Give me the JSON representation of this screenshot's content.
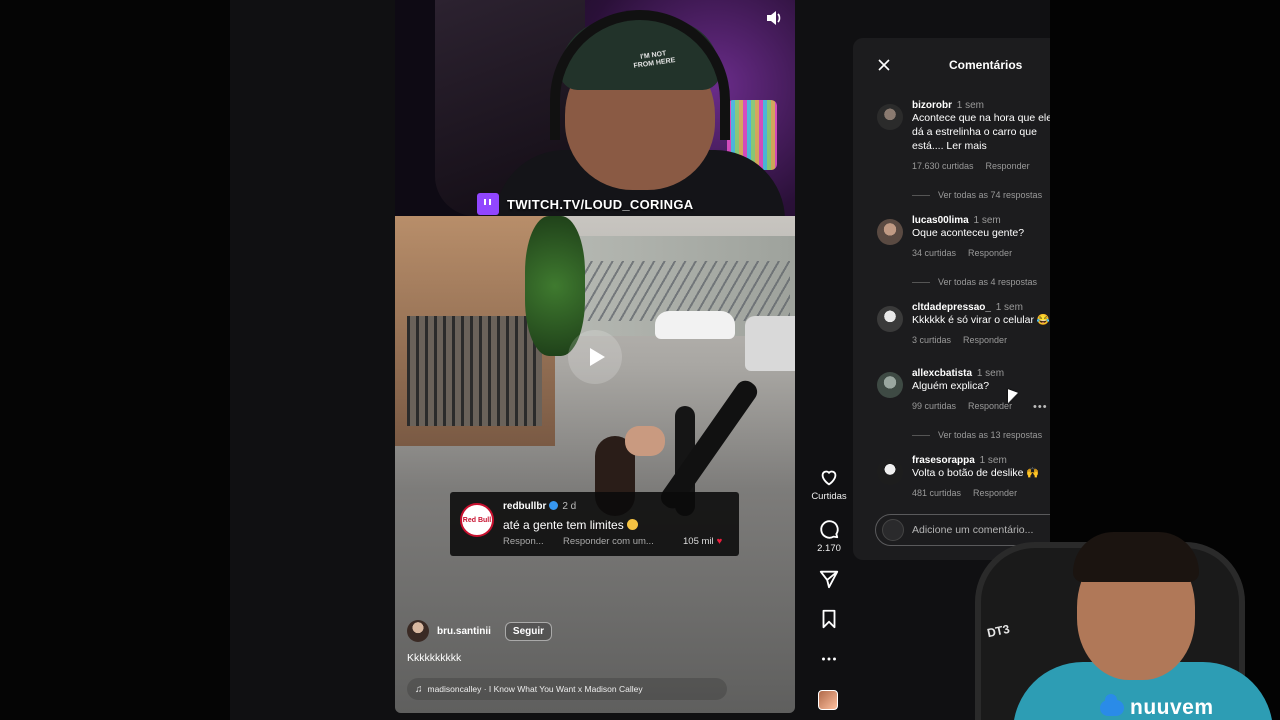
{
  "video": {
    "stream_overlay": "TWITCH.TV/LOUD_CORINGA",
    "cap_text": "I'M NOT\nFROM HERE",
    "reply_card": {
      "brand_logo": "Red Bull",
      "username": "redbullbr",
      "time": "2 d",
      "text": "até a gente tem limites",
      "reply_label": "Respon...",
      "reply_with_label": "Responder com um...",
      "likes": "105 mil"
    },
    "owner": {
      "username": "bru.santinii",
      "follow_label": "Seguir"
    },
    "caption": "Kkkkkkkkkk",
    "music": "madisoncalley · I Know What You Want x Madison Calley"
  },
  "rail": {
    "like_label": "Curtidas",
    "comment_count": "2.170"
  },
  "comments_panel": {
    "title": "Comentários",
    "input_placeholder": "Adicione um comentário...",
    "comments": [
      {
        "username": "bizorobr",
        "time": "1 sem",
        "text": "Acontece que na hora que ele\ndá a estrelinha o carro que\nestá.... Ler mais",
        "likes": "17.630 curtidas",
        "reply_label": "Responder",
        "view_replies": "Ver todas as 74 respostas"
      },
      {
        "username": "lucas00lima",
        "time": "1 sem",
        "text": "Oque aconteceu gente?",
        "likes": "34 curtidas",
        "reply_label": "Responder",
        "view_replies": "Ver todas as 4 respostas"
      },
      {
        "username": "cltdadepressao_",
        "time": "1 sem",
        "text": "Kkkkkk é só virar o celular 😂",
        "likes": "3 curtidas",
        "reply_label": "Responder",
        "view_replies": ""
      },
      {
        "username": "allexcbatista",
        "time": "1 sem",
        "text": "Alguém explica?",
        "likes": "99 curtidas",
        "reply_label": "Responder",
        "view_replies": "Ver todas as 13 respostas"
      },
      {
        "username": "frasesorappa",
        "time": "1 sem",
        "text": "Volta o botão de deslike 🙌",
        "likes": "481 curtidas",
        "reply_label": "Responder",
        "view_replies": ""
      }
    ]
  },
  "webcam": {
    "chair_logo": "DT3"
  },
  "watermark": {
    "brand": "nuuvem"
  },
  "colors": {
    "twitch_purple": "#9146ff",
    "panel_bg": "#1c1c1e",
    "heart_red": "#ed1d3c",
    "verified_blue": "#3797f0",
    "nuvem_blue": "#2a8be8"
  },
  "icons": {
    "close": "close-icon",
    "volume": "volume-icon",
    "play": "play-icon",
    "like": "heart-icon",
    "comment": "comment-icon",
    "share": "send-icon",
    "save": "bookmark-icon",
    "more": "more-icon",
    "music": "music-note-icon"
  }
}
